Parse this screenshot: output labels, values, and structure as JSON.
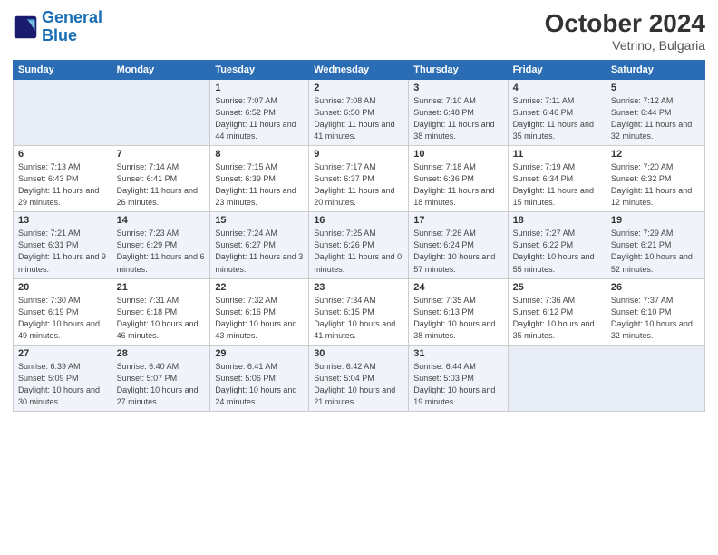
{
  "header": {
    "logo_general": "General",
    "logo_blue": "Blue",
    "month": "October 2024",
    "location": "Vetrino, Bulgaria"
  },
  "days_of_week": [
    "Sunday",
    "Monday",
    "Tuesday",
    "Wednesday",
    "Thursday",
    "Friday",
    "Saturday"
  ],
  "weeks": [
    [
      {
        "day": "",
        "empty": true
      },
      {
        "day": "",
        "empty": true
      },
      {
        "day": "1",
        "sunrise": "Sunrise: 7:07 AM",
        "sunset": "Sunset: 6:52 PM",
        "daylight": "Daylight: 11 hours and 44 minutes."
      },
      {
        "day": "2",
        "sunrise": "Sunrise: 7:08 AM",
        "sunset": "Sunset: 6:50 PM",
        "daylight": "Daylight: 11 hours and 41 minutes."
      },
      {
        "day": "3",
        "sunrise": "Sunrise: 7:10 AM",
        "sunset": "Sunset: 6:48 PM",
        "daylight": "Daylight: 11 hours and 38 minutes."
      },
      {
        "day": "4",
        "sunrise": "Sunrise: 7:11 AM",
        "sunset": "Sunset: 6:46 PM",
        "daylight": "Daylight: 11 hours and 35 minutes."
      },
      {
        "day": "5",
        "sunrise": "Sunrise: 7:12 AM",
        "sunset": "Sunset: 6:44 PM",
        "daylight": "Daylight: 11 hours and 32 minutes."
      }
    ],
    [
      {
        "day": "6",
        "sunrise": "Sunrise: 7:13 AM",
        "sunset": "Sunset: 6:43 PM",
        "daylight": "Daylight: 11 hours and 29 minutes."
      },
      {
        "day": "7",
        "sunrise": "Sunrise: 7:14 AM",
        "sunset": "Sunset: 6:41 PM",
        "daylight": "Daylight: 11 hours and 26 minutes."
      },
      {
        "day": "8",
        "sunrise": "Sunrise: 7:15 AM",
        "sunset": "Sunset: 6:39 PM",
        "daylight": "Daylight: 11 hours and 23 minutes."
      },
      {
        "day": "9",
        "sunrise": "Sunrise: 7:17 AM",
        "sunset": "Sunset: 6:37 PM",
        "daylight": "Daylight: 11 hours and 20 minutes."
      },
      {
        "day": "10",
        "sunrise": "Sunrise: 7:18 AM",
        "sunset": "Sunset: 6:36 PM",
        "daylight": "Daylight: 11 hours and 18 minutes."
      },
      {
        "day": "11",
        "sunrise": "Sunrise: 7:19 AM",
        "sunset": "Sunset: 6:34 PM",
        "daylight": "Daylight: 11 hours and 15 minutes."
      },
      {
        "day": "12",
        "sunrise": "Sunrise: 7:20 AM",
        "sunset": "Sunset: 6:32 PM",
        "daylight": "Daylight: 11 hours and 12 minutes."
      }
    ],
    [
      {
        "day": "13",
        "sunrise": "Sunrise: 7:21 AM",
        "sunset": "Sunset: 6:31 PM",
        "daylight": "Daylight: 11 hours and 9 minutes."
      },
      {
        "day": "14",
        "sunrise": "Sunrise: 7:23 AM",
        "sunset": "Sunset: 6:29 PM",
        "daylight": "Daylight: 11 hours and 6 minutes."
      },
      {
        "day": "15",
        "sunrise": "Sunrise: 7:24 AM",
        "sunset": "Sunset: 6:27 PM",
        "daylight": "Daylight: 11 hours and 3 minutes."
      },
      {
        "day": "16",
        "sunrise": "Sunrise: 7:25 AM",
        "sunset": "Sunset: 6:26 PM",
        "daylight": "Daylight: 11 hours and 0 minutes."
      },
      {
        "day": "17",
        "sunrise": "Sunrise: 7:26 AM",
        "sunset": "Sunset: 6:24 PM",
        "daylight": "Daylight: 10 hours and 57 minutes."
      },
      {
        "day": "18",
        "sunrise": "Sunrise: 7:27 AM",
        "sunset": "Sunset: 6:22 PM",
        "daylight": "Daylight: 10 hours and 55 minutes."
      },
      {
        "day": "19",
        "sunrise": "Sunrise: 7:29 AM",
        "sunset": "Sunset: 6:21 PM",
        "daylight": "Daylight: 10 hours and 52 minutes."
      }
    ],
    [
      {
        "day": "20",
        "sunrise": "Sunrise: 7:30 AM",
        "sunset": "Sunset: 6:19 PM",
        "daylight": "Daylight: 10 hours and 49 minutes."
      },
      {
        "day": "21",
        "sunrise": "Sunrise: 7:31 AM",
        "sunset": "Sunset: 6:18 PM",
        "daylight": "Daylight: 10 hours and 46 minutes."
      },
      {
        "day": "22",
        "sunrise": "Sunrise: 7:32 AM",
        "sunset": "Sunset: 6:16 PM",
        "daylight": "Daylight: 10 hours and 43 minutes."
      },
      {
        "day": "23",
        "sunrise": "Sunrise: 7:34 AM",
        "sunset": "Sunset: 6:15 PM",
        "daylight": "Daylight: 10 hours and 41 minutes."
      },
      {
        "day": "24",
        "sunrise": "Sunrise: 7:35 AM",
        "sunset": "Sunset: 6:13 PM",
        "daylight": "Daylight: 10 hours and 38 minutes."
      },
      {
        "day": "25",
        "sunrise": "Sunrise: 7:36 AM",
        "sunset": "Sunset: 6:12 PM",
        "daylight": "Daylight: 10 hours and 35 minutes."
      },
      {
        "day": "26",
        "sunrise": "Sunrise: 7:37 AM",
        "sunset": "Sunset: 6:10 PM",
        "daylight": "Daylight: 10 hours and 32 minutes."
      }
    ],
    [
      {
        "day": "27",
        "sunrise": "Sunrise: 6:39 AM",
        "sunset": "Sunset: 5:09 PM",
        "daylight": "Daylight: 10 hours and 30 minutes."
      },
      {
        "day": "28",
        "sunrise": "Sunrise: 6:40 AM",
        "sunset": "Sunset: 5:07 PM",
        "daylight": "Daylight: 10 hours and 27 minutes."
      },
      {
        "day": "29",
        "sunrise": "Sunrise: 6:41 AM",
        "sunset": "Sunset: 5:06 PM",
        "daylight": "Daylight: 10 hours and 24 minutes."
      },
      {
        "day": "30",
        "sunrise": "Sunrise: 6:42 AM",
        "sunset": "Sunset: 5:04 PM",
        "daylight": "Daylight: 10 hours and 21 minutes."
      },
      {
        "day": "31",
        "sunrise": "Sunrise: 6:44 AM",
        "sunset": "Sunset: 5:03 PM",
        "daylight": "Daylight: 10 hours and 19 minutes."
      },
      {
        "day": "",
        "empty": true
      },
      {
        "day": "",
        "empty": true
      }
    ]
  ]
}
